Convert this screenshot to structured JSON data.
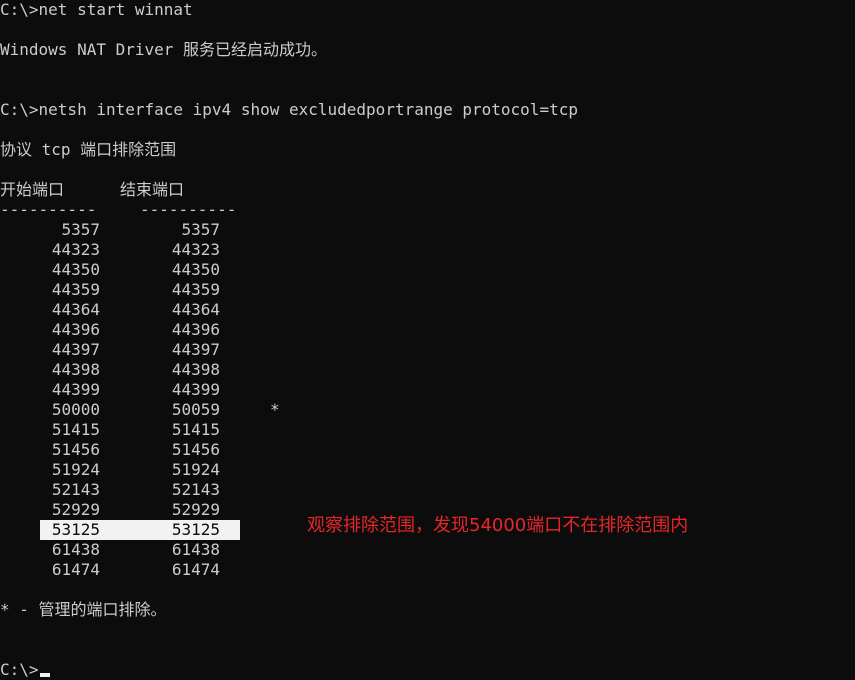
{
  "terminal": {
    "line1": "C:\\>net start winnat",
    "line2": "Windows NAT Driver 服务已经启动成功。",
    "line3": "C:\\>netsh interface ipv4 show excludedportrange protocol=tcp",
    "line4": "协议 tcp 端口排除范围",
    "col_start_header": "开始端口",
    "col_end_header": "结束端口",
    "col_start_dashes": "----------",
    "col_end_dashes": "----------",
    "rows": [
      {
        "start": "5357",
        "end": "5357",
        "mark": ""
      },
      {
        "start": "44323",
        "end": "44323",
        "mark": ""
      },
      {
        "start": "44350",
        "end": "44350",
        "mark": ""
      },
      {
        "start": "44359",
        "end": "44359",
        "mark": ""
      },
      {
        "start": "44364",
        "end": "44364",
        "mark": ""
      },
      {
        "start": "44396",
        "end": "44396",
        "mark": ""
      },
      {
        "start": "44397",
        "end": "44397",
        "mark": ""
      },
      {
        "start": "44398",
        "end": "44398",
        "mark": ""
      },
      {
        "start": "44399",
        "end": "44399",
        "mark": ""
      },
      {
        "start": "50000",
        "end": "50059",
        "mark": "*"
      },
      {
        "start": "51415",
        "end": "51415",
        "mark": ""
      },
      {
        "start": "51456",
        "end": "51456",
        "mark": ""
      },
      {
        "start": "51924",
        "end": "51924",
        "mark": ""
      },
      {
        "start": "52143",
        "end": "52143",
        "mark": ""
      },
      {
        "start": "52929",
        "end": "52929",
        "mark": ""
      },
      {
        "start": "53125",
        "end": "53125",
        "mark": ""
      },
      {
        "start": "61438",
        "end": "61438",
        "mark": ""
      },
      {
        "start": "61474",
        "end": "61474",
        "mark": ""
      }
    ],
    "footnote": "* - 管理的端口排除。",
    "prompt": "C:\\>"
  },
  "annotation": {
    "text": "观察排除范围，发现54000端口不在排除范围内",
    "color": "#e8262a"
  },
  "colors": {
    "background": "#0c0c0c",
    "foreground": "#cccccc",
    "selection": "#f2f2f2"
  }
}
